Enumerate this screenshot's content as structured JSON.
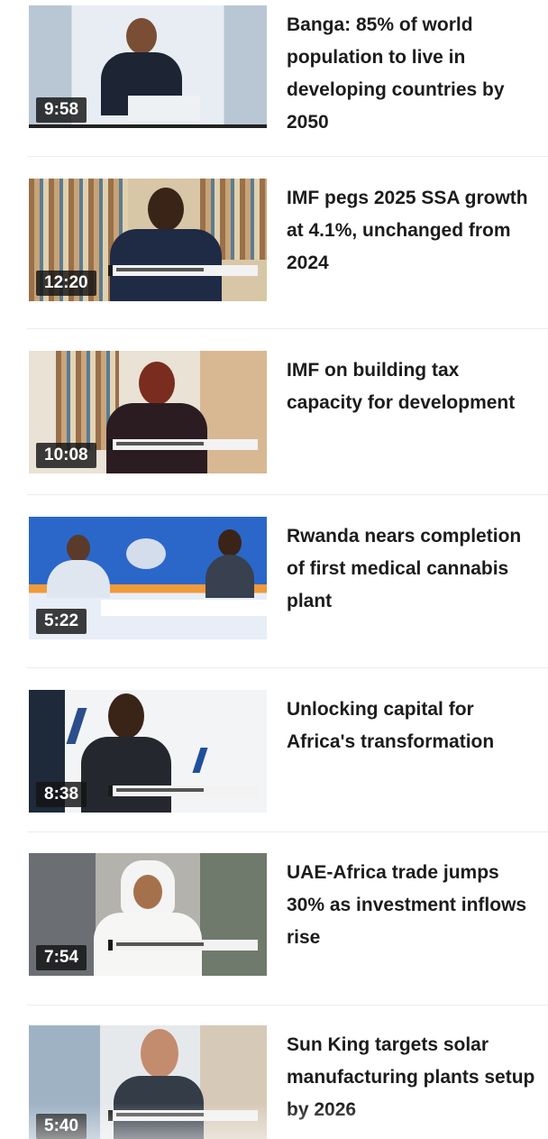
{
  "videos": [
    {
      "duration": "9:58",
      "title": "Banga: 85% of world population to live in developing countries by 2050"
    },
    {
      "duration": "12:20",
      "title": "IMF pegs 2025 SSA growth at 4.1%, unchanged from 2024"
    },
    {
      "duration": "10:08",
      "title": "IMF on building tax capacity for development"
    },
    {
      "duration": "5:22",
      "title": "Rwanda nears completion of first medical cannabis plant"
    },
    {
      "duration": "8:38",
      "title": "Unlocking capital for Africa's transformation"
    },
    {
      "duration": "7:54",
      "title": "UAE-Africa trade jumps 30% as investment inflows rise"
    },
    {
      "duration": "5:40",
      "title": "Sun King targets solar manufacturing plants setup by 2026"
    }
  ],
  "icons": {
    "play_overlay": "video-thumbnail"
  },
  "colors": {
    "text": "#1c1c1c",
    "duration_bg": "#141414",
    "cnbc_blue": "#1d4fa3"
  }
}
